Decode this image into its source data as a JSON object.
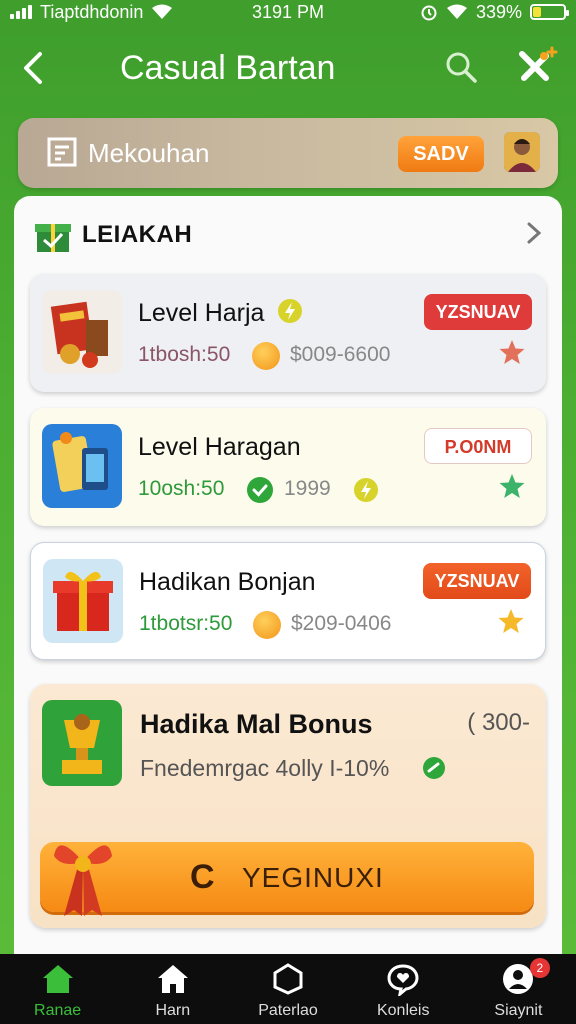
{
  "status_bar": {
    "carrier": "Tiaptdhdonin",
    "time": "3191 PM",
    "battery": "339%",
    "battery_level": 0.25
  },
  "header": {
    "title": "Casual Bartan"
  },
  "banner": {
    "label": "Mekouhan",
    "button_label": "SADV"
  },
  "section": {
    "title": "LEIAKAH"
  },
  "items": [
    {
      "title": "Level Harja",
      "meta_left": "1tbosh:50",
      "meta_right": "$009-6600",
      "badge": "YZSNUAV",
      "badge_style": "red",
      "star_color": "#e2705a"
    },
    {
      "title": "Level Haragan",
      "meta_left": "10osh:50",
      "meta_right": "1999",
      "badge": "P.O0NM",
      "badge_style": "outline",
      "star_color": "#3bb36a"
    },
    {
      "title": "Hadikan Bonjan",
      "meta_left": "1tbotsr:50",
      "meta_right": "$209-0406",
      "badge": "YZSNUAV",
      "badge_style": "orange",
      "star_color": "#f5b929"
    }
  ],
  "bonus": {
    "title": "Hadika Mal Bonus",
    "amount": "( 300-",
    "subtitle": "Fnedemrgac 4olly I-10%",
    "button_icon": "C",
    "button_label": "YEGINUXI"
  },
  "nav": [
    {
      "label": "Ranae",
      "icon": "home-icon",
      "active": true
    },
    {
      "label": "Harn",
      "icon": "house-icon",
      "active": false
    },
    {
      "label": "Paterlao",
      "icon": "hexagon-icon",
      "active": false
    },
    {
      "label": "Konleis",
      "icon": "chat-heart-icon",
      "active": false
    },
    {
      "label": "Siaynit",
      "icon": "profile-icon",
      "active": false,
      "badge": "2"
    }
  ],
  "colors": {
    "accent_green": "#4cae32",
    "orange": "#f58a14",
    "red_badge": "#e03b3b"
  }
}
